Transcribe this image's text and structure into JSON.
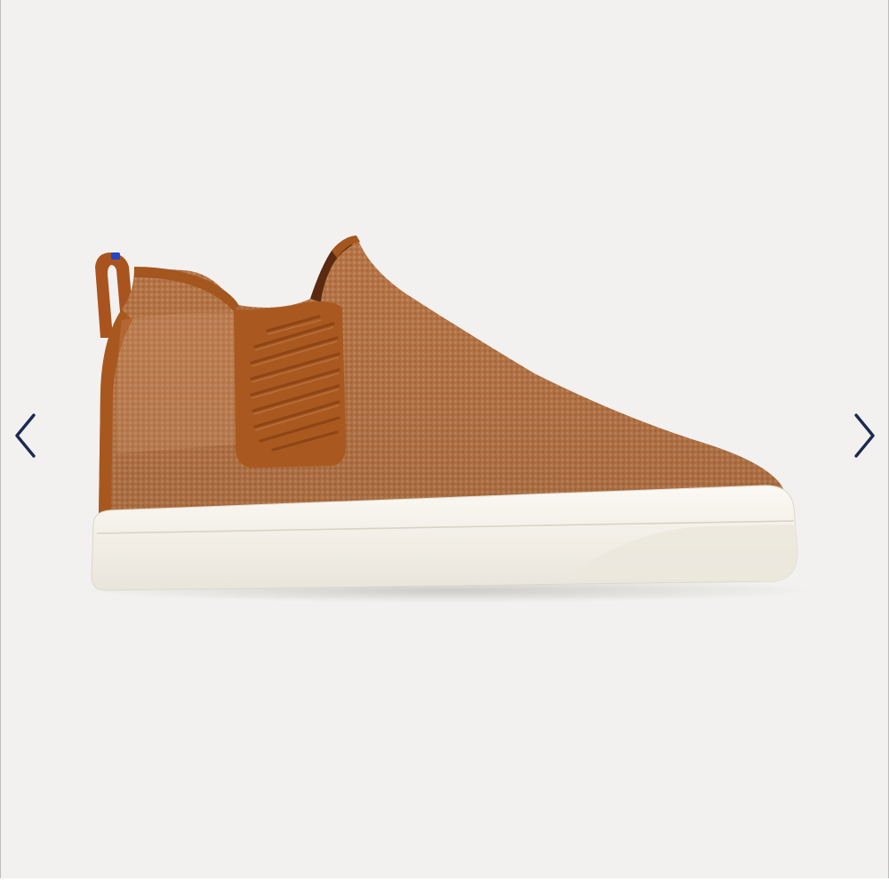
{
  "carousel": {
    "image_subject": "slip-on-sneaker",
    "prev_icon": "chevron-left-icon",
    "next_icon": "chevron-right-icon"
  },
  "colors": {
    "background": "#f2f1ef",
    "arrow": "#1b2a52",
    "upper_knit": "#bf7a48",
    "upper_dark": "#a0501d",
    "sole": "#f1eee6"
  }
}
